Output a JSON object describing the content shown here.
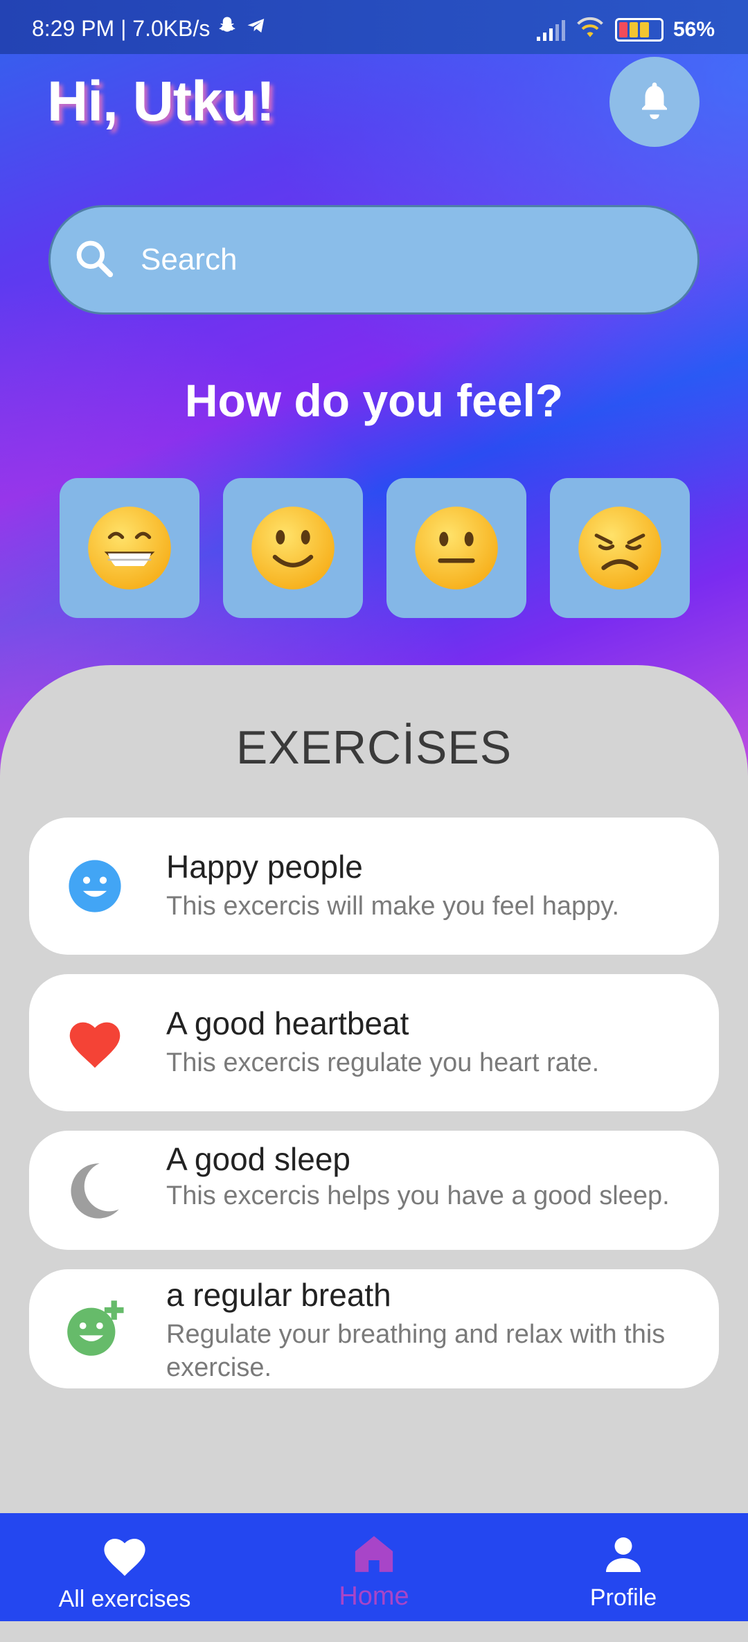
{
  "status_bar": {
    "left_text": "8:29 PM | 7.0KB/s",
    "battery_percent": "56%",
    "icons": [
      "snapchat-icon",
      "telegram-icon",
      "signal-icon",
      "wifi-icon",
      "battery-icon"
    ]
  },
  "header": {
    "greeting": "Hi, Utku!",
    "bell_icon": "bell-icon"
  },
  "search": {
    "placeholder": "Search",
    "icon": "search-icon"
  },
  "mood": {
    "title": "How do you feel?",
    "options": [
      {
        "name": "grinning-face-icon"
      },
      {
        "name": "slightly-smiling-face-icon"
      },
      {
        "name": "neutral-face-icon"
      },
      {
        "name": "disappointed-face-icon"
      }
    ]
  },
  "exercises": {
    "title": "EXERCİSES",
    "items": [
      {
        "title": "Happy people",
        "description": "This excercis will make you feel happy.",
        "icon": "smile-face-icon",
        "icon_color": "#42a5f5"
      },
      {
        "title": "A good heartbeat",
        "description": "This excercis regulate you heart rate.",
        "icon": "heart-icon",
        "icon_color": "#f44336"
      },
      {
        "title": "A good sleep",
        "description": "This excercis helps you have a good sleep.",
        "icon": "moon-icon",
        "icon_color": "#9e9e9e"
      },
      {
        "title": "a regular breath",
        "description": "Regulate your breathing and relax with this exercise.",
        "icon": "add-reaction-icon",
        "icon_color": "#66bb6a"
      }
    ]
  },
  "bottom_nav": {
    "items": [
      {
        "label": "All exercises",
        "icon": "heart-icon"
      },
      {
        "label": "Home",
        "icon": "home-icon",
        "active": true
      },
      {
        "label": "Profile",
        "icon": "person-icon"
      }
    ],
    "background": "#2447f0",
    "active_color": "#a845c8"
  }
}
